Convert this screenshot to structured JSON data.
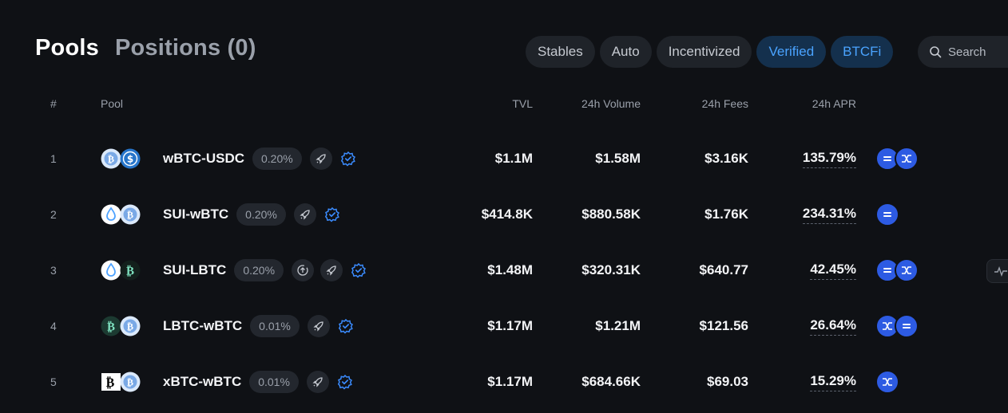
{
  "tabs": {
    "pools": "Pools",
    "positions": "Positions (0)"
  },
  "filters": [
    "Stables",
    "Auto",
    "Incentivized",
    "Verified",
    "BTCFi"
  ],
  "search": {
    "placeholder": "Search"
  },
  "columns": {
    "rank": "#",
    "pool": "Pool",
    "tvl": "TVL",
    "volume": "24h Volume",
    "fees": "24h Fees",
    "apr": "24h APR"
  },
  "rows": [
    {
      "rank": "1",
      "name": "wBTC-USDC",
      "fee": "0.20%",
      "tvl": "$1.1M",
      "volume": "$1.58M",
      "fees": "$3.16K",
      "apr": "135.79%"
    },
    {
      "rank": "2",
      "name": "SUI-wBTC",
      "fee": "0.20%",
      "tvl": "$414.8K",
      "volume": "$880.58K",
      "fees": "$1.76K",
      "apr": "234.31%"
    },
    {
      "rank": "3",
      "name": "SUI-LBTC",
      "fee": "0.20%",
      "tvl": "$1.48M",
      "volume": "$320.31K",
      "fees": "$640.77",
      "apr": "42.45%"
    },
    {
      "rank": "4",
      "name": "LBTC-wBTC",
      "fee": "0.01%",
      "tvl": "$1.17M",
      "volume": "$1.21M",
      "fees": "$121.56",
      "apr": "26.64%"
    },
    {
      "rank": "5",
      "name": "xBTC-wBTC",
      "fee": "0.01%",
      "tvl": "$1.17M",
      "volume": "$684.66K",
      "fees": "$69.03",
      "apr": "15.29%"
    }
  ],
  "icons": {
    "coins": [
      "wbtc-icon",
      "usdc-icon",
      "sui-icon",
      "lbtc-icon",
      "xbtc-icon"
    ],
    "row_actions": [
      "rocket-icon",
      "verified-badge-icon",
      "stake-icon"
    ],
    "rewards": [
      "equals-reward-icon",
      "swap-reward-icon"
    ]
  },
  "colors": {
    "accent": "#4aa3ff",
    "reward": "#2d5be3",
    "background": "#0f1115"
  }
}
